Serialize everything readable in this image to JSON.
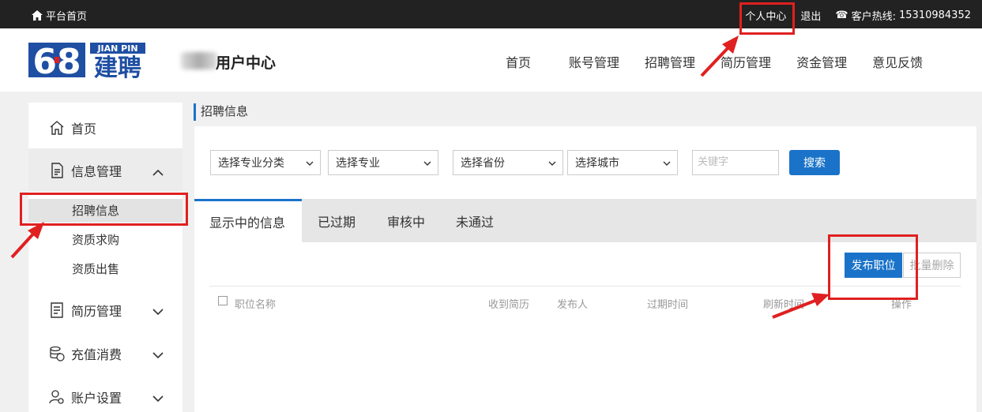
{
  "topbar": {
    "home_label": "平台首页",
    "personal_center": "个人中心",
    "logout": "退出",
    "hotline_label": "客户热线:",
    "hotline_number": "15310984352"
  },
  "header": {
    "logo_number": "68",
    "logo_en": "JIAN PIN",
    "logo_cn": "建聘",
    "user_center": "用户中心",
    "nav": [
      "首页",
      "账号管理",
      "招聘管理",
      "简历管理",
      "资金管理",
      "意见反馈"
    ]
  },
  "sidebar": {
    "home": "首页",
    "info_mgmt": "信息管理",
    "sub_items": [
      "招聘信息",
      "资质求购",
      "资质出售"
    ],
    "resume_mgmt": "简历管理",
    "recharge": "充值消费",
    "account": "账户设置"
  },
  "breadcrumb": "招聘信息",
  "filters": {
    "category": "选择专业分类",
    "major": "选择专业",
    "province": "选择省份",
    "city": "选择城市",
    "keyword_placeholder": "关键字",
    "search": "搜索"
  },
  "tabs": [
    "显示中的信息",
    "已过期",
    "审核中",
    "未通过"
  ],
  "actions": {
    "publish": "发布职位",
    "batch_delete": "批量删除"
  },
  "table_headers": {
    "position": "职位名称",
    "resumes": "收到简历",
    "publisher": "发布人",
    "expire": "过期时间",
    "refresh": "刷新时间",
    "ops": "操作"
  },
  "colors": {
    "accent": "#1a73c9",
    "annotation": "#e02020",
    "topbar": "#222222"
  }
}
